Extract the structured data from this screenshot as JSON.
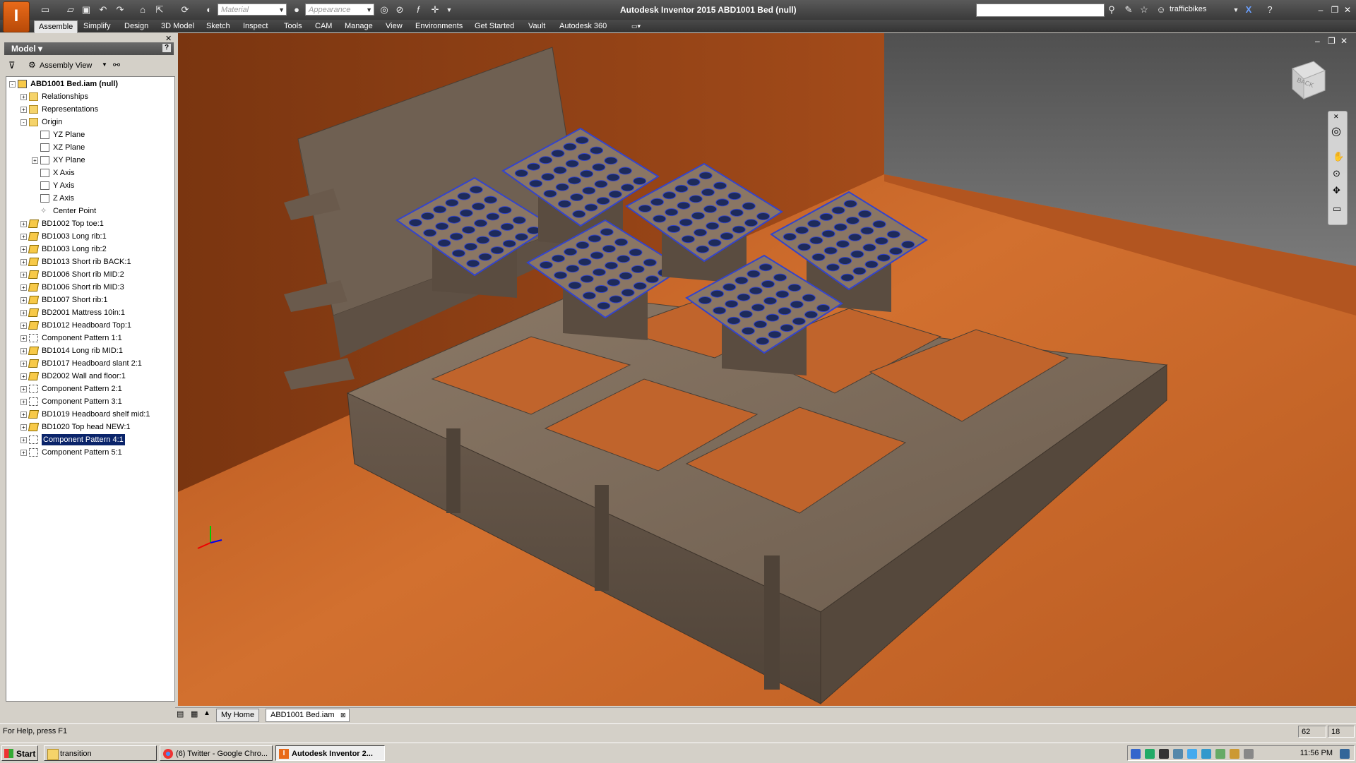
{
  "window": {
    "title": "Autodesk Inventor 2015    ABD1001 Bed (null)",
    "app_icon": "inventor-app-icon",
    "user": "trafficbikes"
  },
  "quick_access": {
    "material_placeholder": "Material",
    "appearance_placeholder": "Appearance"
  },
  "ribbon_tabs": [
    "Assemble",
    "Simplify",
    "Design",
    "3D Model",
    "Sketch",
    "Inspect",
    "Tools",
    "CAM",
    "Manage",
    "View",
    "Environments",
    "Get Started",
    "Vault",
    "Autodesk 360"
  ],
  "browser": {
    "header": "Model ▾",
    "view_label": "Assembly View",
    "tree": [
      {
        "label": "ABD1001 Bed.iam (null)",
        "icon": "asm",
        "depth": 0,
        "bold": true,
        "exp": "-"
      },
      {
        "label": "Relationships",
        "icon": "folder",
        "depth": 1,
        "exp": "+"
      },
      {
        "label": "Representations",
        "icon": "folder",
        "depth": 1,
        "exp": "+"
      },
      {
        "label": "Origin",
        "icon": "folder",
        "depth": 1,
        "exp": "-"
      },
      {
        "label": "YZ Plane",
        "icon": "plane",
        "depth": 2,
        "exp": ""
      },
      {
        "label": "XZ Plane",
        "icon": "plane",
        "depth": 2,
        "exp": ""
      },
      {
        "label": "XY Plane",
        "icon": "plane",
        "depth": 2,
        "exp": "+"
      },
      {
        "label": "X Axis",
        "icon": "plane",
        "depth": 2,
        "exp": ""
      },
      {
        "label": "Y Axis",
        "icon": "plane",
        "depth": 2,
        "exp": ""
      },
      {
        "label": "Z Axis",
        "icon": "plane",
        "depth": 2,
        "exp": ""
      },
      {
        "label": "Center Point",
        "icon": "point",
        "depth": 2,
        "exp": ""
      },
      {
        "label": "BD1002 Top toe:1",
        "icon": "part",
        "depth": 1,
        "exp": "+"
      },
      {
        "label": "BD1003 Long rib:1",
        "icon": "part",
        "depth": 1,
        "exp": "+"
      },
      {
        "label": "BD1003 Long rib:2",
        "icon": "part",
        "depth": 1,
        "exp": "+"
      },
      {
        "label": "BD1013 Short rib BACK:1",
        "icon": "part",
        "depth": 1,
        "exp": "+"
      },
      {
        "label": "BD1006 Short rib MID:2",
        "icon": "part",
        "depth": 1,
        "exp": "+"
      },
      {
        "label": "BD1006 Short rib MID:3",
        "icon": "part",
        "depth": 1,
        "exp": "+"
      },
      {
        "label": "BD1007 Short rib:1",
        "icon": "part",
        "depth": 1,
        "exp": "+"
      },
      {
        "label": "BD2001 Mattress 10in:1",
        "icon": "part",
        "depth": 1,
        "exp": "+"
      },
      {
        "label": "BD1012 Headboard Top:1",
        "icon": "part",
        "depth": 1,
        "exp": "+"
      },
      {
        "label": "Component Pattern 1:1",
        "icon": "pattern",
        "depth": 1,
        "exp": "+"
      },
      {
        "label": "BD1014 Long rib MID:1",
        "icon": "part",
        "depth": 1,
        "exp": "+"
      },
      {
        "label": "BD1017 Headboard slant 2:1",
        "icon": "part",
        "depth": 1,
        "exp": "+"
      },
      {
        "label": "BD2002 Wall and floor:1",
        "icon": "part",
        "depth": 1,
        "exp": "+"
      },
      {
        "label": "Component Pattern 2:1",
        "icon": "pattern",
        "depth": 1,
        "exp": "+"
      },
      {
        "label": "Component Pattern 3:1",
        "icon": "pattern",
        "depth": 1,
        "exp": "+"
      },
      {
        "label": "BD1019 Headboard shelf mid:1",
        "icon": "part",
        "depth": 1,
        "exp": "+"
      },
      {
        "label": "BD1020 Top head NEW:1",
        "icon": "part",
        "depth": 1,
        "exp": "+"
      },
      {
        "label": "Component Pattern 4:1",
        "icon": "pattern",
        "depth": 1,
        "exp": "+",
        "selected": true
      },
      {
        "label": "Component Pattern 5:1",
        "icon": "pattern",
        "depth": 1,
        "exp": "+"
      }
    ]
  },
  "viewcube_label": "BACK",
  "doc_tabs": [
    "My Home",
    "ABD1001 Bed.iam"
  ],
  "status": {
    "help_text": "For Help, press F1",
    "count1": "62",
    "count2": "18"
  },
  "taskbar": {
    "start_label": "Start",
    "tasks": [
      "transition",
      "(6) Twitter - Google Chro...",
      "Autodesk Inventor 2..."
    ],
    "clock": "11:56 PM"
  },
  "colors": {
    "floor": "#c6642a",
    "wood": "#7a6a5a",
    "selection_edge": "#3344cc",
    "accent": "#e86a1a"
  }
}
